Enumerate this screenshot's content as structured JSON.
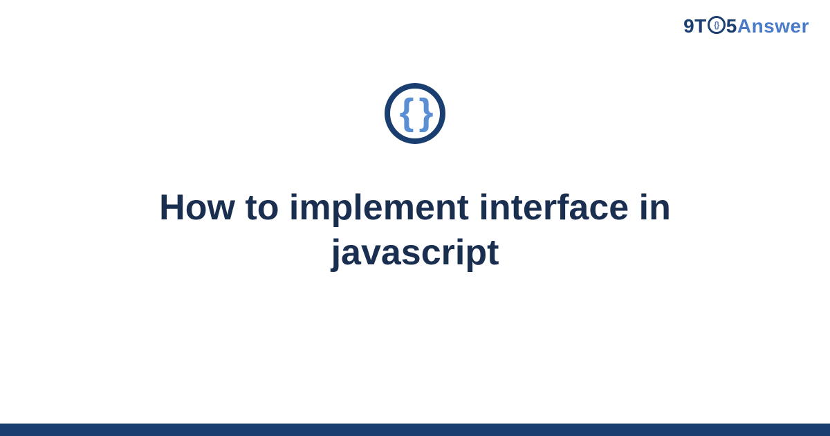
{
  "logo": {
    "part1": "9T",
    "o_inner": "{}",
    "part3": "5",
    "answer": "Answer"
  },
  "icon": {
    "glyph": "{ }",
    "name": "code-braces-icon"
  },
  "title": "How to implement interface in javascript",
  "colors": {
    "dark_navy": "#1a3e6f",
    "light_blue": "#5a8fd4",
    "mid_blue": "#4a7bc8",
    "text_dark": "#1a2f4f"
  }
}
